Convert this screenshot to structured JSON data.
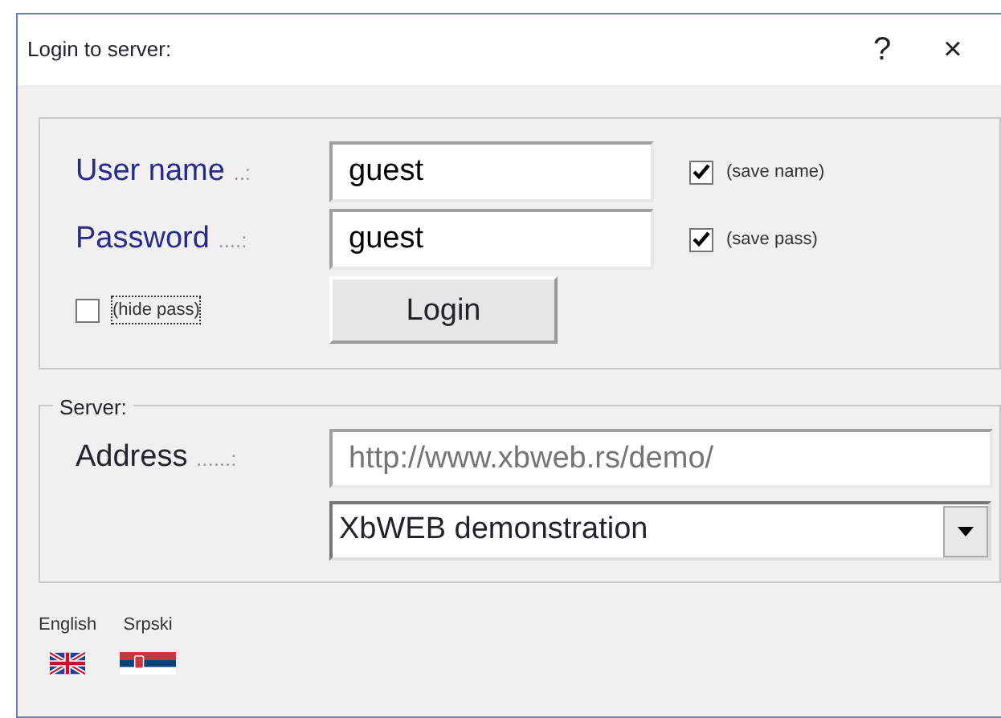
{
  "window": {
    "title": "Login to server:",
    "help": "?",
    "close": "×"
  },
  "login": {
    "fields": [
      {
        "label": "User name",
        "dots": "..:",
        "value": "guest",
        "save_label": "(save name)",
        "save_checked": true
      },
      {
        "label": "Password",
        "dots": "....:",
        "value": "guest",
        "save_label": "(save pass)",
        "save_checked": true
      }
    ],
    "hide_pass": {
      "label": "(hide pass)",
      "checked": false
    },
    "button": "Login"
  },
  "server": {
    "legend": "Server:",
    "address_label": "Address",
    "address_dots": "......:",
    "address_placeholder": "http://www.xbweb.rs/demo/",
    "selection": "XbWEB demonstration"
  },
  "languages": [
    {
      "label": "English",
      "kind": "uk"
    },
    {
      "label": "Srpski",
      "kind": "rs"
    }
  ]
}
